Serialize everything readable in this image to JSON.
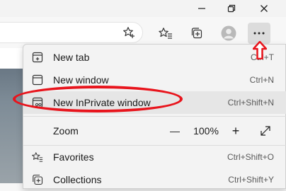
{
  "window": {
    "minimize_icon": "minimize-icon",
    "restore_icon": "restore-icon",
    "close_icon": "close-icon"
  },
  "toolbar": {
    "add_favorite_icon": "star-plus-icon",
    "favorites_icon": "favorites-icon",
    "collections_icon": "collections-icon",
    "profile_icon": "profile-avatar-icon",
    "more_icon": "ellipsis-icon"
  },
  "menu": {
    "items": [
      {
        "label": "New tab",
        "shortcut": "Ctrl+T",
        "icon": "new-tab-icon"
      },
      {
        "label": "New window",
        "shortcut": "Ctrl+N",
        "icon": "new-window-icon"
      },
      {
        "label": "New InPrivate window",
        "shortcut": "Ctrl+Shift+N",
        "icon": "inprivate-window-icon"
      },
      {
        "label": "Zoom",
        "icon": ""
      },
      {
        "label": "Favorites",
        "shortcut": "Ctrl+Shift+O",
        "icon": "favorites-icon"
      },
      {
        "label": "Collections",
        "shortcut": "Ctrl+Shift+Y",
        "icon": "collections-icon"
      }
    ],
    "zoom": {
      "minus": "—",
      "level": "100%",
      "plus": "+",
      "fullscreen_icon": "fullscreen-icon"
    }
  },
  "annotation": {
    "highlight_color": "#e8141c"
  }
}
